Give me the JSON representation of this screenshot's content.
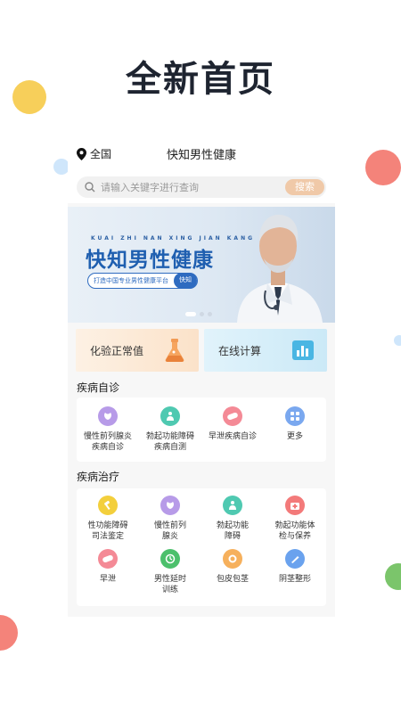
{
  "colors": {
    "dot_yellow": "#f7cf5a",
    "dot_coral": "#f4837a",
    "dot_lightblue": "#cfe6fb",
    "dot_green": "#7bc56b",
    "brand_blue": "#1f5fb0",
    "search_button": "#f0c9a8"
  },
  "headline": "全新首页",
  "topbar": {
    "location_icon": "map-pin-icon",
    "location": "全国",
    "title": "快知男性健康"
  },
  "search": {
    "icon": "search-icon",
    "placeholder": "请输入关键字进行查询",
    "button": "搜索"
  },
  "banner": {
    "pinyin": "KUAI ZHI NAN XING JIAN KANG",
    "title": "快知男性健康",
    "tagline": "打造中国专业男性健康平台",
    "logo": "快知",
    "image": "doctor-photo"
  },
  "quick_links": [
    {
      "label": "化验正常值",
      "icon": "flask-icon"
    },
    {
      "label": "在线计算",
      "icon": "chart-icon"
    }
  ],
  "self_diagnosis": {
    "title": "疾病自诊",
    "items": [
      {
        "lines": [
          "慢性前列腺炎",
          "疾病自诊"
        ],
        "icon": "gland-icon",
        "color": "#b79be8"
      },
      {
        "lines": [
          "勃起功能障碍",
          "疾病自测"
        ],
        "icon": "body-icon",
        "color": "#4fc9b1"
      },
      {
        "lines": [
          "早泄疾病自诊",
          ""
        ],
        "icon": "pill-icon",
        "color": "#f48a96"
      },
      {
        "lines": [
          "更多",
          ""
        ],
        "icon": "grid-more-icon",
        "color": "#7aa8ef"
      }
    ]
  },
  "treatment": {
    "title": "疾病治疗",
    "items": [
      {
        "lines": [
          "性功能障碍",
          "司法鉴定"
        ],
        "icon": "gavel-icon",
        "color": "#f3cf3c"
      },
      {
        "lines": [
          "慢性前列",
          "腺炎"
        ],
        "icon": "gland-icon",
        "color": "#b79be8"
      },
      {
        "lines": [
          "勃起功能",
          "障碍"
        ],
        "icon": "body-icon",
        "color": "#4fc9b1"
      },
      {
        "lines": [
          "勃起功能体",
          "检与保养"
        ],
        "icon": "medkit-icon",
        "color": "#f37a7a"
      },
      {
        "lines": [
          "早泄",
          ""
        ],
        "icon": "pill-icon",
        "color": "#f48a96"
      },
      {
        "lines": [
          "男性延时",
          "训练"
        ],
        "icon": "timer-icon",
        "color": "#4cc06c"
      },
      {
        "lines": [
          "包皮包茎",
          ""
        ],
        "icon": "ring-icon",
        "color": "#f6b05c"
      },
      {
        "lines": [
          "阴茎整形",
          ""
        ],
        "icon": "scalpel-icon",
        "color": "#6aa2ee"
      }
    ]
  }
}
